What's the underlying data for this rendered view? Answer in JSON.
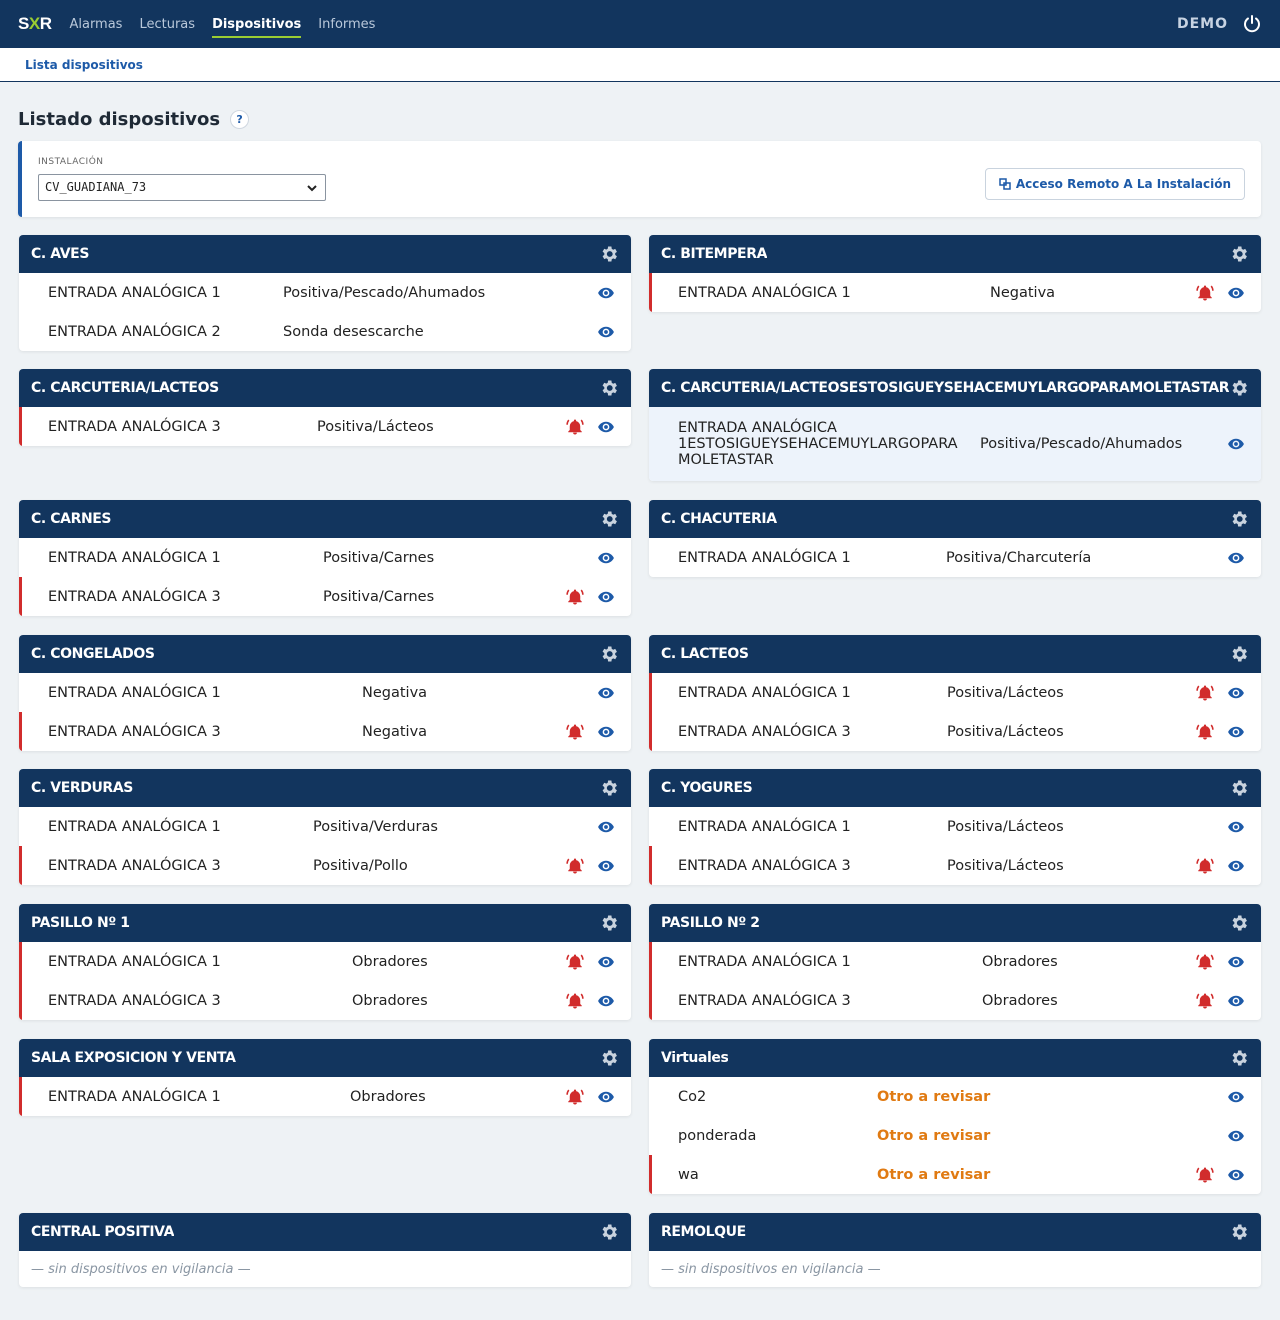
{
  "nav": {
    "logo_a": "S",
    "logo_b": "X",
    "logo_c": "R",
    "links": [
      "Alarmas",
      "Lecturas",
      "Dispositivos",
      "Informes"
    ],
    "active": "Dispositivos",
    "user": "DEMO"
  },
  "subnav": {
    "link": "Lista dispositivos"
  },
  "page": {
    "title": "Listado dispositivos",
    "help": "?"
  },
  "filter": {
    "label": "INSTALACIÓN",
    "selected": "CV_GUADIANA_73",
    "remote_button": "Acceso Remoto A La Instalación"
  },
  "colors": {
    "navy": "#12355e",
    "accent": "#9acd32",
    "link": "#1d5aa8",
    "alarm": "#d12c2c",
    "warning": "#e07a12"
  },
  "cards": [
    {
      "title": "C. AVES",
      "rows": [
        {
          "name": "ENTRADA ANALÓGICA 1",
          "desc": "Positiva/Pescado/Ahumados",
          "alarm": false
        },
        {
          "name": "ENTRADA ANALÓGICA 2",
          "desc": "Sonda desescarche",
          "alarm": false
        }
      ]
    },
    {
      "title": "C. BITEMPERA",
      "rows": [
        {
          "name": "ENTRADA ANALÓGICA 1",
          "desc": "Negativa",
          "alarm": true
        }
      ]
    },
    {
      "title": "C. CARCUTERIA/LACTEOS",
      "rows": [
        {
          "name": "ENTRADA ANALÓGICA 3",
          "desc": "Positiva/Lácteos",
          "alarm": true
        }
      ]
    },
    {
      "title": "C. CARCUTERIA/LACTEOSESTOSIGUEYSEHACEMUYLARGOPARAMOLETASTAR",
      "rows": [
        {
          "name": "ENTRADA ANALÓGICA 1ESTOSIGUEYSEHACEMUYLARGOPARA MOLETASTAR",
          "desc": "Positiva/Pescado/Ahumados",
          "alarm": false
        }
      ]
    },
    {
      "title": "C. CARNES",
      "rows": [
        {
          "name": "ENTRADA ANALÓGICA 1",
          "desc": "Positiva/Carnes",
          "alarm": false
        },
        {
          "name": "ENTRADA ANALÓGICA 3",
          "desc": "Positiva/Carnes",
          "alarm": true
        }
      ]
    },
    {
      "title": "C. CHACUTERIA",
      "rows": [
        {
          "name": "ENTRADA ANALÓGICA 1",
          "desc": "Positiva/Charcutería",
          "alarm": false
        }
      ]
    },
    {
      "title": "C. CONGELADOS",
      "rows": [
        {
          "name": "ENTRADA ANALÓGICA 1",
          "desc": "Negativa",
          "alarm": false
        },
        {
          "name": "ENTRADA ANALÓGICA 3",
          "desc": "Negativa",
          "alarm": true
        }
      ]
    },
    {
      "title": "C. LACTEOS",
      "rows": [
        {
          "name": "ENTRADA ANALÓGICA 1",
          "desc": "Positiva/Lácteos",
          "alarm": true
        },
        {
          "name": "ENTRADA ANALÓGICA 3",
          "desc": "Positiva/Lácteos",
          "alarm": true
        }
      ]
    },
    {
      "title": "C. VERDURAS",
      "rows": [
        {
          "name": "ENTRADA ANALÓGICA 1",
          "desc": "Positiva/Verduras",
          "alarm": false
        },
        {
          "name": "ENTRADA ANALÓGICA 3",
          "desc": "Positiva/Pollo",
          "alarm": true
        }
      ]
    },
    {
      "title": "C. YOGURES",
      "rows": [
        {
          "name": "ENTRADA ANALÓGICA 1",
          "desc": "Positiva/Lácteos",
          "alarm": false
        },
        {
          "name": "ENTRADA ANALÓGICA 3",
          "desc": "Positiva/Lácteos",
          "alarm": true
        }
      ]
    },
    {
      "title": "PASILLO Nº 1",
      "rows": [
        {
          "name": "ENTRADA ANALÓGICA 1",
          "desc": "Obradores",
          "alarm": true
        },
        {
          "name": "ENTRADA ANALÓGICA 3",
          "desc": "Obradores",
          "alarm": true
        }
      ]
    },
    {
      "title": "PASILLO Nº 2",
      "rows": [
        {
          "name": "ENTRADA ANALÓGICA 1",
          "desc": "Obradores",
          "alarm": true
        },
        {
          "name": "ENTRADA ANALÓGICA 3",
          "desc": "Obradores",
          "alarm": true
        }
      ]
    },
    {
      "title": "SALA EXPOSICION Y VENTA",
      "rows": [
        {
          "name": "ENTRADA ANALÓGICA 1",
          "desc": "Obradores",
          "alarm": true
        }
      ]
    },
    {
      "title": "Virtuales",
      "rows": [
        {
          "name": "Co2",
          "desc": "Otro a revisar",
          "alarm": false
        },
        {
          "name": "ponderada",
          "desc": "Otro a revisar",
          "alarm": false
        },
        {
          "name": "wa",
          "desc": "Otro a revisar",
          "alarm": true
        }
      ]
    },
    {
      "title": "CENTRAL POSITIVA",
      "rows": [],
      "empty": "— sin dispositivos en vigilancia —"
    },
    {
      "title": "REMOLQUE",
      "rows": [],
      "empty": "— sin dispositivos en vigilancia —"
    }
  ]
}
